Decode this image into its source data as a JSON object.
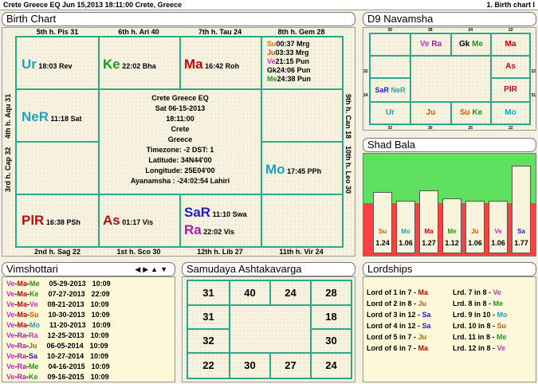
{
  "topbar": {
    "left": "Crete Greece EQ  Jun 15,2013 18:11:00   Crete, Greece",
    "right": "1. Birth chart I"
  },
  "birth_chart": {
    "title": "Birth Chart",
    "houses": {
      "h5": "5th h. Pis 31",
      "h6": "6th h. Ari 40",
      "h7": "7th h. Tau 24",
      "h8": "8th h. Gem 28",
      "h4": "4th h. Aqu 31",
      "h9": "9th h. Can 18",
      "h3": "3rd h. Cap 32",
      "h10": "10th h. Leo 30",
      "h2": "2nd h. Sag 22",
      "h1": "1st h. Sco 30",
      "h12": "12th h. Lib 27",
      "h11": "11th h. Vir 24"
    },
    "planets": {
      "ur": {
        "abbr": "Ur",
        "deg": "18:03 Rev"
      },
      "ke": {
        "abbr": "Ke",
        "deg": "22:02 Bha"
      },
      "ma": {
        "abbr": "Ma",
        "deg": "16:42 Roh"
      },
      "ner": {
        "abbr": "NeR",
        "deg": "11:18 Sat"
      },
      "mo": {
        "abbr": "Mo",
        "deg": "17:45 PPh"
      },
      "plr": {
        "abbr": "PlR",
        "deg": "16:38 PSh"
      },
      "as": {
        "abbr": "As",
        "deg": "01:17 Vis"
      },
      "sar": {
        "abbr": "SaR",
        "deg": "11:10 Swa"
      },
      "ra": {
        "abbr": "Ra",
        "deg": "22:02 Vis"
      }
    },
    "gem_list": [
      {
        "abbr": "Su",
        "deg": "00:37 Mrg",
        "color": "#e07b00"
      },
      {
        "abbr": "Ju",
        "deg": "03:33 Mrg",
        "color": "#c85a00"
      },
      {
        "abbr": "Ve",
        "deg": "21:15 Pun",
        "color": "#d030c0"
      },
      {
        "abbr": "Gk",
        "deg": "24:06 Pun",
        "color": "#000000"
      },
      {
        "abbr": "Me",
        "deg": "24:38 Pun",
        "color": "#1a9a1a"
      }
    ],
    "center": {
      "line1": "Crete Greece EQ",
      "line2": "Sat 06-15-2013",
      "line3": "18:11:00",
      "line4": "Crete",
      "line5": "Greece",
      "line6": "Timezone: -2 DST: 1",
      "line7": "Latitude: 34N44'00",
      "line8": "Longitude: 25E04'00",
      "line9": "Ayanamsha : -24:02:54 Lahiri"
    }
  },
  "navamsha": {
    "title": "D9 Navamsha",
    "top_nums": [
      "30",
      "28",
      "24",
      "22"
    ],
    "left_nums": [
      "32",
      "24"
    ],
    "right_nums": [
      "22",
      "31"
    ],
    "bottom_nums": [
      "33",
      "30",
      "25",
      "22"
    ],
    "cells": {
      "vera": [
        "Ve",
        "Ra"
      ],
      "gkme": [
        "Gk",
        "Me"
      ],
      "ma": "Ma",
      "as": "As",
      "plr": "PlR",
      "sarner": [
        "SaR",
        "NeR"
      ],
      "ur": "Ur",
      "ju": "Ju",
      "suke": [
        "Su",
        "Ke"
      ],
      "mo": "Mo"
    }
  },
  "shad_bala": {
    "title": "Shad Bala",
    "planets": [
      {
        "abbr": "Su",
        "value": "1.24",
        "color": "#c85a00",
        "strength": 1.24
      },
      {
        "abbr": "Mo",
        "value": "1.06",
        "color": "#20a0c0",
        "strength": 1.06
      },
      {
        "abbr": "Ma",
        "value": "1.27",
        "color": "#cc0000",
        "strength": 1.27
      },
      {
        "abbr": "Me",
        "value": "1.12",
        "color": "#1a9a1a",
        "strength": 1.12
      },
      {
        "abbr": "Ju",
        "value": "1.06",
        "color": "#c85a00",
        "strength": 1.06
      },
      {
        "abbr": "Ve",
        "value": "1.06",
        "color": "#d030c0",
        "strength": 1.06
      },
      {
        "abbr": "Sa",
        "value": "1.77",
        "color": "#1a1ad0",
        "strength": 1.77
      }
    ]
  },
  "vimshottari": {
    "title": "Vimshottari",
    "nav": [
      "◀",
      "▶",
      "▲",
      "▼"
    ],
    "rows": [
      {
        "p1": "Ve",
        "p2": "Ma",
        "p3": "Me",
        "c3": "#1a9a1a",
        "date": "05-29-2013",
        "time": "10:09"
      },
      {
        "p1": "Ve",
        "p2": "Ma",
        "p3": "Ke",
        "c3": "#1a9a1a",
        "date": "07-27-2013",
        "time": "22:09"
      },
      {
        "p1": "Ve",
        "p2": "Ma",
        "p3": "Ve",
        "c3": "#d030c0",
        "date": "08-21-2013",
        "time": "10:09"
      },
      {
        "p1": "Ve",
        "p2": "Ma",
        "p3": "Su",
        "c3": "#c85a00",
        "date": "10-30-2013",
        "time": "10:09"
      },
      {
        "p1": "Ve",
        "p2": "Ma",
        "p3": "Mo",
        "c3": "#20a0c0",
        "date": "11-20-2013",
        "time": "10:09"
      },
      {
        "p1": "Ve",
        "p2": "Ra",
        "p3": "Ra",
        "c3": "#d030c0",
        "date": "12-25-2013",
        "time": "10:09"
      },
      {
        "p1": "Ve",
        "p2": "Ra",
        "p3": "Ju",
        "c3": "#c85a00",
        "date": "06-05-2014",
        "time": "10:09"
      },
      {
        "p1": "Ve",
        "p2": "Ra",
        "p3": "Sa",
        "c3": "#1a1ad0",
        "date": "10-27-2014",
        "time": "10:09"
      },
      {
        "p1": "Ve",
        "p2": "Ra",
        "p3": "Me",
        "c3": "#1a9a1a",
        "date": "04-16-2015",
        "time": "10:09"
      },
      {
        "p1": "Ve",
        "p2": "Ra",
        "p3": "Ke",
        "c3": "#1a9a1a",
        "date": "09-16-2015",
        "time": "10:09"
      }
    ]
  },
  "ashtakavarga": {
    "title": "Samudaya Ashtakavarga",
    "cells": {
      "c11": "31",
      "c12": "40",
      "c13": "24",
      "c14": "28",
      "c21": "31",
      "c24": "18",
      "c31": "32",
      "c34": "30",
      "c41": "22",
      "c42": "30",
      "c43": "27",
      "c44": "24"
    }
  },
  "lordships": {
    "title": "Lordships",
    "left": [
      {
        "text": "Lord of 1 in 7 - ",
        "p": "Ma",
        "c": "#cc0000"
      },
      {
        "text": "Lord of 2 in 8 - ",
        "p": "Ju",
        "c": "#c85a00"
      },
      {
        "text": "Lord of 3 in 12 - ",
        "p": "Sa",
        "c": "#1a1ad0"
      },
      {
        "text": "Lord of 4 in 12 - ",
        "p": "Sa",
        "c": "#1a1ad0"
      },
      {
        "text": "Lord of 5 in 7 - ",
        "p": "Ju",
        "c": "#c85a00"
      },
      {
        "text": "Lord of 6 in 7 - ",
        "p": "Ma",
        "c": "#cc0000"
      }
    ],
    "right": [
      {
        "text": "Lrd. 7 in 8 - ",
        "p": "Ve",
        "c": "#d030c0"
      },
      {
        "text": "Lrd. 8 in 8 - ",
        "p": "Me",
        "c": "#1a9a1a"
      },
      {
        "text": "Lrd. 9 in 10 - ",
        "p": "Mo",
        "c": "#20a0c0"
      },
      {
        "text": "Lrd. 10 in 8 - ",
        "p": "Su",
        "c": "#c85a00"
      },
      {
        "text": "Lrd. 11 in 8 - ",
        "p": "Me",
        "c": "#1a9a1a"
      },
      {
        "text": "Lrd. 12 in 8 - ",
        "p": "Ve",
        "c": "#d030c0"
      }
    ]
  },
  "colors": {
    "teal": "#2aaa8c",
    "green_bg": "#5fe05f",
    "red_bg": "#ff4040"
  }
}
